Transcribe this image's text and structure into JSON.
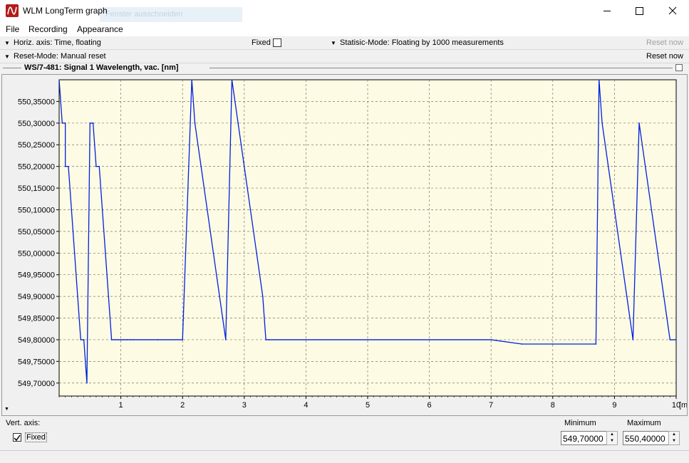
{
  "window": {
    "title": "WLM LongTerm graph",
    "ghost_text": "Fenster ausschneiden",
    "min_icon": "minimize-icon",
    "max_icon": "maximize-icon",
    "close_icon": "close-icon"
  },
  "menu": [
    "File",
    "Recording",
    "Appearance"
  ],
  "toolbar1": {
    "horiz_axis": "Horiz. axis: Time,  floating",
    "fixed_label": "Fixed",
    "fixed_checked": false,
    "statistic_mode": "Statisic-Mode: Floating by 1000 measurements",
    "reset_label": "Reset now"
  },
  "toolbar2": {
    "reset_mode": "Reset-Mode: Manual reset",
    "reset_label": "Reset now"
  },
  "graph_title": "WS/7-481: Signal 1  Wavelength, vac.  [nm]",
  "chart_data": {
    "type": "line",
    "xlabel": "[min]",
    "ylabel": "",
    "xlim": [
      0,
      10
    ],
    "ylim": [
      549.67,
      550.4
    ],
    "x_ticks": [
      "1",
      "2",
      "3",
      "4",
      "5",
      "6",
      "7",
      "8",
      "9",
      "10"
    ],
    "y_ticks": [
      "549,70000",
      "549,75000",
      "549,80000",
      "549,85000",
      "549,90000",
      "549,95000",
      "550,00000",
      "550,05000",
      "550,10000",
      "550,15000",
      "550,20000",
      "550,25000",
      "550,30000",
      "550,35000"
    ],
    "grid": true,
    "series": [
      {
        "color": "#0020e0",
        "x": [
          0,
          0.05,
          0.1,
          0.1,
          0.15,
          0.2,
          0.25,
          0.3,
          0.35,
          0.4,
          0.45,
          0.5,
          0.55,
          0.6,
          0.65,
          0.7,
          0.75,
          0.8,
          0.85,
          0.9,
          0.95,
          1.0,
          1.05,
          1.1,
          1.15,
          1.2,
          1.6,
          2.0,
          2.15,
          2.2,
          2.3,
          2.4,
          2.5,
          2.6,
          2.7,
          2.8,
          2.9,
          3.0,
          3.1,
          3.2,
          3.3,
          3.35,
          3.4,
          4.0,
          5.0,
          6.0,
          7.0,
          7.5,
          8.0,
          8.7,
          8.75,
          8.8,
          8.9,
          9.0,
          9.1,
          9.2,
          9.3,
          9.4,
          9.5,
          9.6,
          9.7,
          9.8,
          9.9,
          10.0
        ],
        "y": [
          550.4,
          550.3,
          550.3,
          550.2,
          550.2,
          550.1,
          550.0,
          549.9,
          549.8,
          549.8,
          549.7,
          550.3,
          550.3,
          550.2,
          550.2,
          550.1,
          550.0,
          549.9,
          549.8,
          549.8,
          549.8,
          549.8,
          549.8,
          549.8,
          549.8,
          549.8,
          549.8,
          549.8,
          550.4,
          550.3,
          550.2,
          550.1,
          550.0,
          549.9,
          549.8,
          550.4,
          550.3,
          550.2,
          550.1,
          550.0,
          549.9,
          549.8,
          549.8,
          549.8,
          549.8,
          549.8,
          549.8,
          549.79,
          549.79,
          549.79,
          550.4,
          550.3,
          550.2,
          550.1,
          550.0,
          549.9,
          549.8,
          550.3,
          550.2,
          550.1,
          550.0,
          549.9,
          549.8,
          549.8
        ]
      }
    ]
  },
  "bottom": {
    "vert_axis_label": "Vert. axis:",
    "fixed_label": "Fixed",
    "fixed_checked": true,
    "minimum_label": "Minimum",
    "maximum_label": "Maximum",
    "minimum_value": "549,70000",
    "maximum_value": "550,40000"
  }
}
